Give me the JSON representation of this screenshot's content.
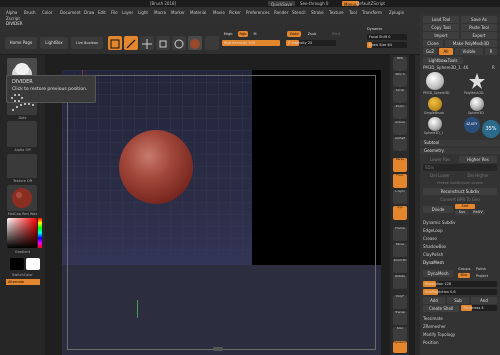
{
  "title_bar": {
    "app": "[Brush 2018]",
    "quicksave": "QuickSave",
    "seethrough": "See-through 0",
    "menus": "Menus",
    "script": "DefaultZScript"
  },
  "menu": {
    "items": [
      "Alpha",
      "Brush",
      "Color",
      "Document",
      "Draw",
      "Edit",
      "File",
      "Layer",
      "Light",
      "Macro",
      "Marker",
      "Material",
      "Movie",
      "Picker",
      "Preferences",
      "Render",
      "Stencil",
      "Stroke",
      "Texture",
      "Tool",
      "Transform",
      "Zplugin",
      "Zscript"
    ],
    "sub": "DIVIDER"
  },
  "shelf": {
    "home_page": "Home Page",
    "lightbox": "LightBox",
    "live_boolean": "Live Boolean",
    "edit": "Edit",
    "draw": "Draw",
    "move": "Move",
    "scale": "Scale",
    "rotate": "Rotate",
    "mrgb": "Mrgb",
    "rgb": "Rgb",
    "m": "M",
    "zadd": "Zadd",
    "zsub": "Zsub",
    "zcut": "Zcut",
    "rgb_intensity": "Rgb Intensity 100",
    "z_intensity": "Z Intensity 25",
    "focal_shift": "Focal Shift 0",
    "draw_size": "Draw Size 64",
    "dynamic": "Dynamic"
  },
  "left_tray": {
    "brush_label": "Standard",
    "stroke_label": "Dots",
    "alpha_label": "Alpha Off",
    "texture_label": "Texture Off",
    "material_label": "MatCap Red Wax",
    "gradient_label": "Gradient",
    "switch_color": "SwitchColor",
    "alternate": "Alternate"
  },
  "tooltip": {
    "title": "DIVIDER",
    "description": "Click to restore previous position."
  },
  "right_nav": {
    "bpr": "BPR",
    "spix": "SPix 3",
    "scroll": "Scroll",
    "zoom": "Zoom",
    "actual": "Actual",
    "aahalf": "AAHalf",
    "persp": "Persp",
    "floor": "Floor",
    "local": "L.Sym",
    "xyz": "Xyz",
    "frame": "Frame",
    "move": "Move",
    "zoom3d": "Zoom3D",
    "rotate": "Rotate",
    "polyf": "PolyF",
    "transp": "Transp",
    "solo": "Solo",
    "dynamic": "Dynamic"
  },
  "palette": {
    "load_tool": "Load Tool",
    "save_as": "Save As",
    "copy_tool": "Copy Tool",
    "paste_tool": "Paste Tool",
    "import": "Import",
    "export": "Export",
    "clone": "Clone",
    "make_polymesh": "Make PolyMesh3D",
    "goz": "GoZ",
    "all": "All",
    "visible": "Visible",
    "r": "R",
    "lightbox_tools": "Lightbox▸Tools",
    "pm3d_label": "PM3D_Sphere3D_1",
    "pm3d_value": "46",
    "r2": "R",
    "thumbs": [
      "PM3D_Sphere3D",
      "PolyMesh3D",
      "SimpleBrush",
      "Sphere3D",
      "Sphere3D_1",
      "4Z-KEY"
    ],
    "counter": "35%",
    "subtool": "Subtool",
    "geometry": "Geometry",
    "lower_res": "Lower Res",
    "higher_res": "Higher Res",
    "sdiv": "SDiv",
    "del_lower": "Del Lower",
    "del_higher": "Del Higher",
    "freeze": "Freeze SubDivision Levels",
    "reconstruct": "Reconstruct Subdiv",
    "convert_bpr": "Convert BPR To Geo",
    "divide": "Divide",
    "smt": "Smt",
    "suv": "Suv",
    "rsub": "ReUV",
    "dynamic_subdiv": "Dynamic Subdiv",
    "edgeloop": "EdgeLoop",
    "crease": "Crease",
    "shadowbox": "ShadowBox",
    "clayp": "ClayPolish",
    "dynamesh": "DynaMesh",
    "dynamesh_btn": "DynaMesh",
    "groups": "Groups",
    "polish": "Polish",
    "blur": "Blur",
    "project": "Project",
    "resolution": "Resolution 128",
    "subprojection": "SubProjection 0.6",
    "add": "Add",
    "sub": "Sub",
    "and": "And",
    "create_shell": "Create Shell",
    "thickness": "Thickness 4",
    "tessimate": "Tessimate",
    "zremesher": "ZRemesher",
    "modify_topology": "Modify Topology",
    "position": "Position"
  }
}
